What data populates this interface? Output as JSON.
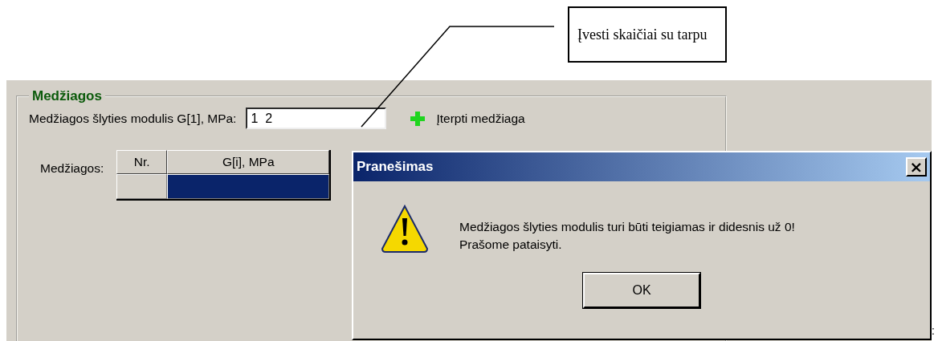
{
  "annotation": {
    "text": "Įvesti skaičiai su tarpu"
  },
  "group": {
    "title": "Medžiagos",
    "field": {
      "label": "Medžiagos šlyties modulis G[1], MPa:",
      "value": "1  2"
    },
    "insert_button": {
      "label": "Įterpti medžiaga"
    },
    "table": {
      "label": "Medžiagos:",
      "columns": [
        "Nr.",
        "G[i], MPa"
      ],
      "rows": [
        {
          "selected": true
        }
      ]
    }
  },
  "dialog": {
    "title": "Pranešimas",
    "close": "×",
    "message_lines": [
      "Medžiagos šlyties modulis turi būti teigiamas ir didesnis už 0!",
      "Prašome pataisyti."
    ],
    "buttons": [
      "OK"
    ]
  },
  "trailing_mark": ":"
}
